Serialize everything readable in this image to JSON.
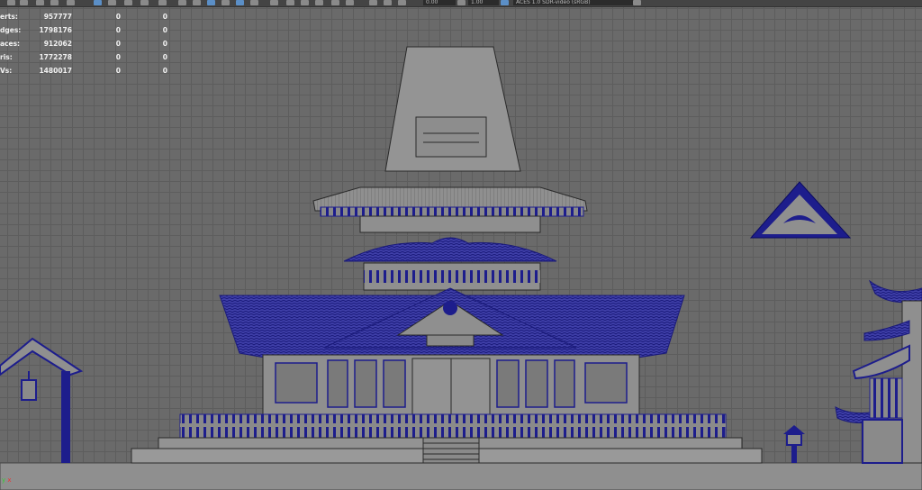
{
  "toolbar": {
    "field_a": "0.00",
    "field_b": "1.00",
    "color_space": "ACES 1.0 SDR-video (sRGB)"
  },
  "hud": {
    "rows": [
      {
        "label": "erts:",
        "v1": "957777",
        "v2": "0",
        "v3": "0"
      },
      {
        "label": "dges:",
        "v1": "1798176",
        "v2": "0",
        "v3": "0"
      },
      {
        "label": "aces:",
        "v1": "912062",
        "v2": "0",
        "v3": "0"
      },
      {
        "label": "ris:",
        "v1": "1772278",
        "v2": "0",
        "v3": "0"
      },
      {
        "label": "Vs:",
        "v1": "1480017",
        "v2": "0",
        "v3": "0"
      }
    ]
  },
  "axis": {
    "y": "y",
    "x": "x"
  },
  "colors": {
    "wire": "#1d1d8c",
    "shaded": "#8f8f8f",
    "dark_line": "#2a2a2a",
    "grid": "#5d5d5d",
    "background": "#6a6a6a"
  }
}
